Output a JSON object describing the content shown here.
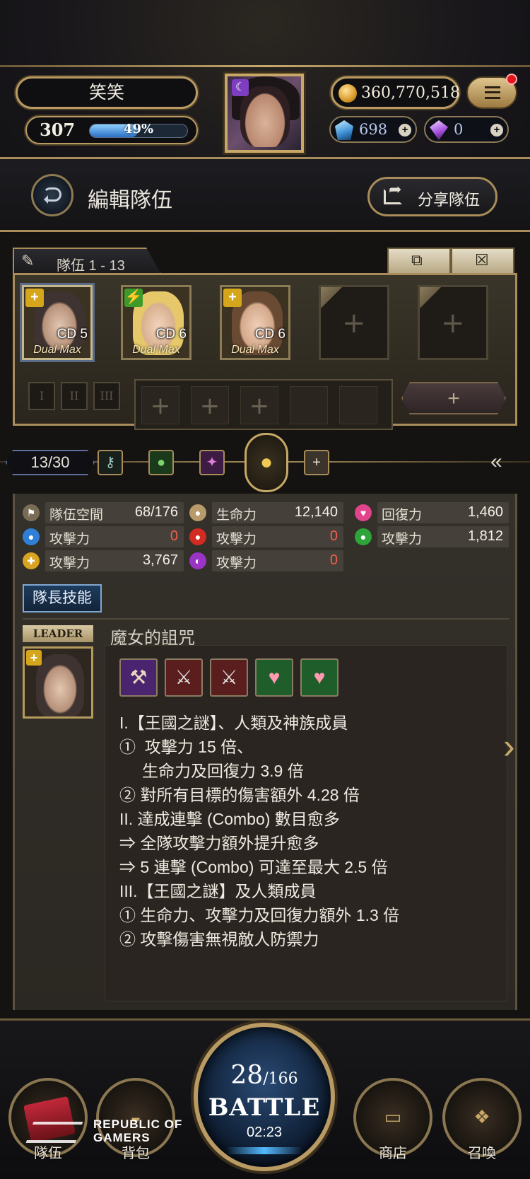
{
  "player": {
    "name": "笑笑",
    "level": "307",
    "exp_percent": "49%",
    "exp_fraction": 0.49,
    "coins": "360,770,518",
    "diamonds": "698",
    "souls": "0"
  },
  "header": {
    "title": "編輯隊伍",
    "share_label": "分享隊伍"
  },
  "team": {
    "tab_label": "隊伍 1 - 13",
    "cards": [
      {
        "cd": "CD 5",
        "dual": "Dual Max",
        "attr_color": "#d5a51c"
      },
      {
        "cd": "CD 6",
        "dual": "Dual Max",
        "attr_color": "#3f9a2c"
      },
      {
        "cd": "CD 6",
        "dual": "Dual Max",
        "attr_color": "#d5a51c"
      }
    ],
    "mini_slots": [
      "I",
      "II",
      "III"
    ]
  },
  "filter": {
    "count": "13/30"
  },
  "stats": [
    {
      "label": "隊伍空間",
      "value": "68/176",
      "icon": "flag-icon",
      "color": "#7a6d55"
    },
    {
      "label": "生命力",
      "value": "12,140",
      "icon": "drop-icon",
      "color": "#b79b6a"
    },
    {
      "label": "回復力",
      "value": "1,460",
      "icon": "heart-icon",
      "color": "#e0448a"
    },
    {
      "label": "攻擊力",
      "value": "0",
      "icon": "water-icon",
      "color": "#2f7fd6",
      "zero": true
    },
    {
      "label": "攻擊力",
      "value": "0",
      "icon": "fire-icon",
      "color": "#d12b22",
      "zero": true
    },
    {
      "label": "攻擊力",
      "value": "1,812",
      "icon": "wood-icon",
      "color": "#2ea43a"
    },
    {
      "label": "攻擊力",
      "value": "3,767",
      "icon": "light-icon",
      "color": "#d8a320"
    },
    {
      "label": "攻擊力",
      "value": "0",
      "icon": "dark-icon",
      "color": "#9a34c4",
      "zero": true
    }
  ],
  "leader_skill": {
    "button_label": "隊長技能",
    "leader_tag": "LEADER",
    "name": "魔女的詛咒",
    "lines": [
      "I.【王國之謎】、人類及神族成員",
      "①  攻擊力 15 倍、",
      "     生命力及回復力 3.9 倍",
      "② 對所有目標的傷害額外 4.28 倍",
      "II. 達成連擊 (Combo) 數目愈多",
      "⇒ 全隊攻擊力額外提升愈多",
      "⇒ 5 連擊 (Combo) 可達至最大 2.5 倍",
      "III.【王國之謎】及人類成員",
      "① 生命力、攻擊力及回復力額外 1.3 倍",
      "② 攻擊傷害無視敵人防禦力"
    ]
  },
  "battle": {
    "stamina_current": "28",
    "stamina_max": "/166",
    "label": "BATTLE",
    "timer": "02:23"
  },
  "nav": {
    "team": "隊伍",
    "bag": "背包",
    "shop": "商店",
    "summon": "召喚"
  },
  "overlay": {
    "brand_line1": "REPUBLIC OF",
    "brand_line2": "GAMERS"
  }
}
